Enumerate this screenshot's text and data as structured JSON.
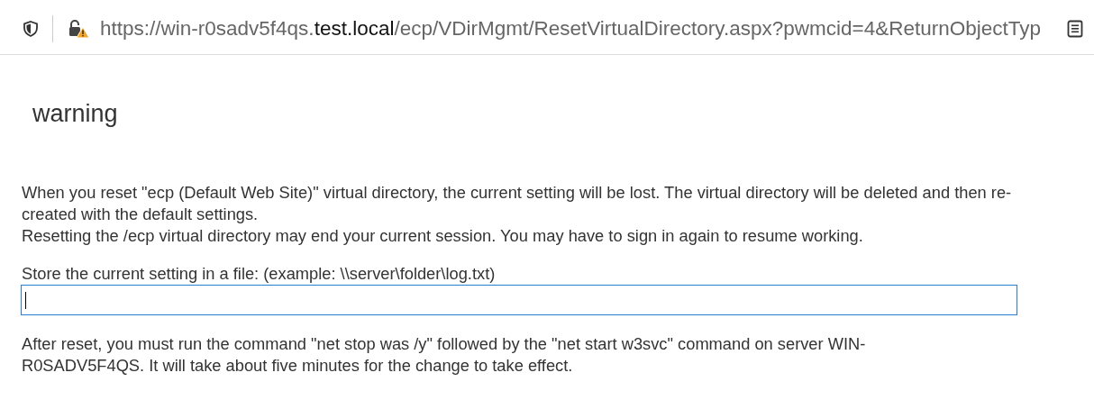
{
  "address_bar": {
    "url": "https://win-r0sadv5f4qs.**test.local**/ecp/VDirMgmt/ResetVirtualDirectory.aspx?pwmcid=4&ReturnObjectTyp"
  },
  "dialog": {
    "title": "warning",
    "paragraphs": [
      "When you reset \"ecp (Default Web Site)\" virtual directory, the current setting will be lost. The virtual directory will be deleted and then re-created with the default settings.",
      "Resetting the /ecp virtual directory may end your current session. You may have to sign in again to resume working."
    ],
    "field_label": "Store the current setting in a file: (example: \\\\server\\folder\\log.txt)",
    "file_field": {
      "focused": true
    },
    "note": "After reset, you must run the command \"net stop was /y\" followed by the \"net start w3svc\" command on server WIN-R0SADV5F4QS. It will take about five minutes for the change to take effect."
  }
}
